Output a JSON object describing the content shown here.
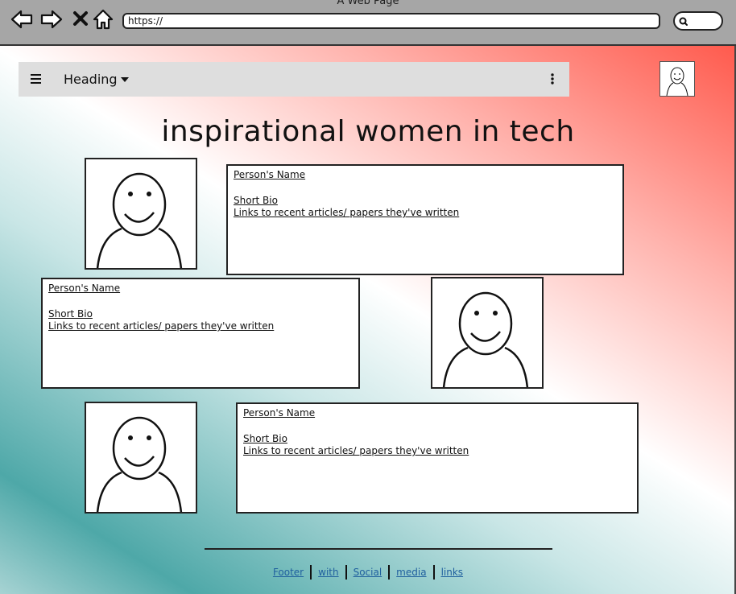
{
  "browser": {
    "window_title": "A Web Page",
    "url": "https://",
    "icons": [
      "back-arrow-icon",
      "forward-arrow-icon",
      "close-icon",
      "home-icon",
      "search-icon"
    ]
  },
  "appbar": {
    "heading": "Heading",
    "icons": [
      "hamburger-menu-icon",
      "caret-down-icon",
      "kebab-menu-icon",
      "user-avatar-icon"
    ]
  },
  "page_title": "inspirational women in tech",
  "profiles": [
    {
      "name": "Person's Name",
      "bio": "Short Bio",
      "links": "Links to recent articles/ papers they've written"
    },
    {
      "name": "Person's Name",
      "bio": "Short Bio",
      "links": "Links to recent articles/ papers they've written"
    },
    {
      "name": "Person's Name",
      "bio": "Short Bio",
      "links": "Links to recent articles/ papers they've written"
    }
  ],
  "footer": {
    "links": [
      "Footer",
      "with",
      "Social",
      "media",
      "links"
    ]
  },
  "colors": {
    "chrome": "#a6a6a6",
    "appbar": "#dedede",
    "gradient_coral": "#ff5a4d",
    "gradient_teal": "#4ea8a8",
    "footer_link": "#1f5f9e"
  }
}
